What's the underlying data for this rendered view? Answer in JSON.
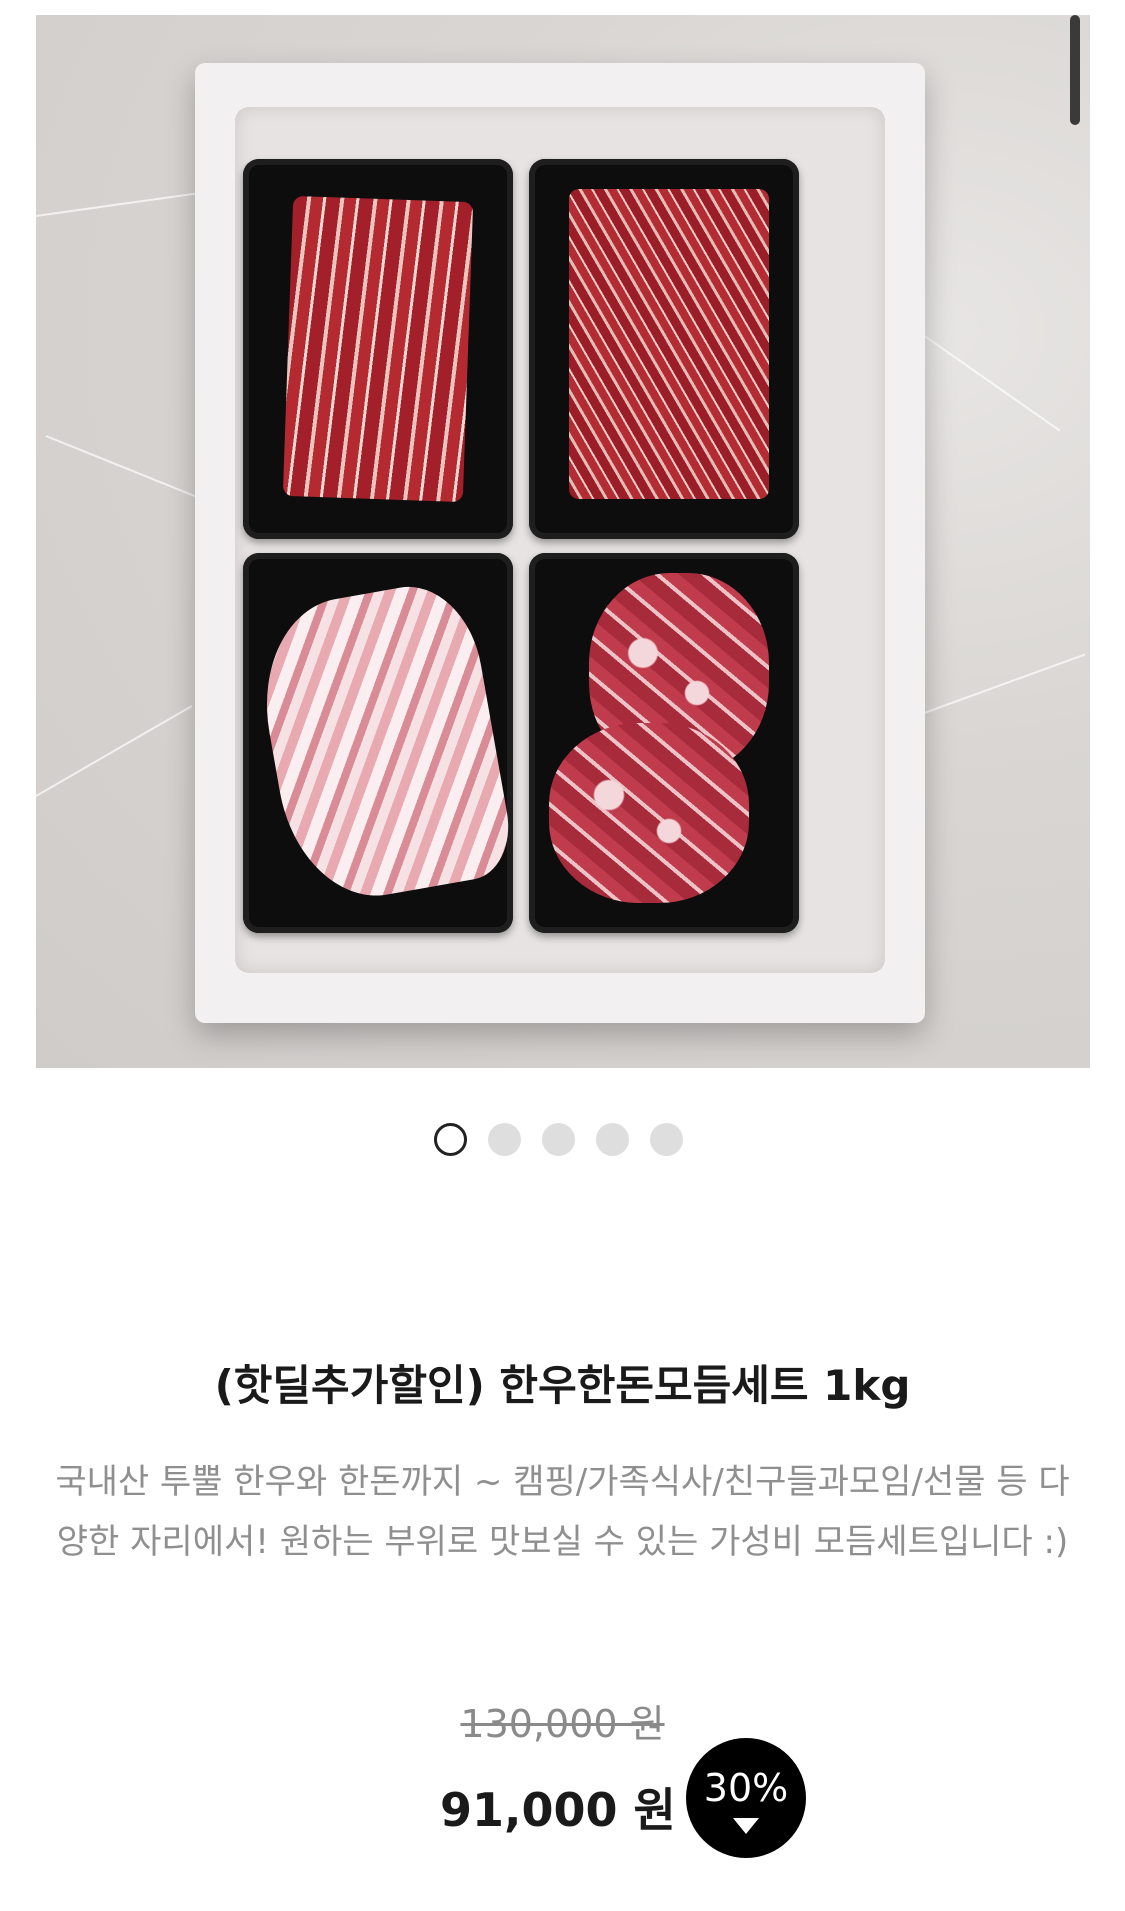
{
  "gallery": {
    "image_alt": "Hanwoo and Handon assortment set in white styrofoam box with four black trays",
    "dot_count": 5,
    "active_index": 0
  },
  "product": {
    "title": "(핫딜추가할인) 한우한돈모듬세트 1kg",
    "description": "국내산 투뿔 한우와 한돈까지 ~ 캠핑/가족식사/친구들과모임/선물 등 다양한 자리에서! 원하는 부위로 맛보실 수 있는 가성비 모듬세트입니다 :)",
    "original_price": "130,000 원",
    "price": "91,000 원",
    "discount": "30%"
  },
  "colors": {
    "discount_badge": "#000000",
    "active_dot_border": "#222222",
    "inactive_dot": "#dedede"
  }
}
